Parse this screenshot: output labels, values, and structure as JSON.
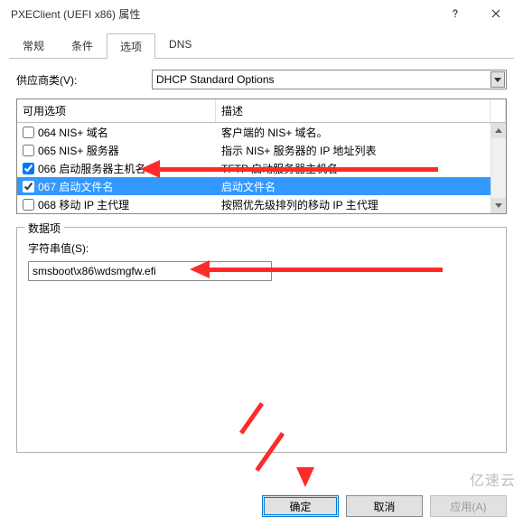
{
  "window": {
    "title": "PXEClient (UEFI x86) 属性"
  },
  "tabs": {
    "items": [
      {
        "label": "常规"
      },
      {
        "label": "条件"
      },
      {
        "label": "选项"
      },
      {
        "label": "DNS"
      }
    ],
    "activeIndex": 2
  },
  "vendor": {
    "label": "供应商类(V):",
    "value": "DHCP Standard Options"
  },
  "options": {
    "headerA": "可用选项",
    "headerB": "描述",
    "rows": [
      {
        "checked": false,
        "code": "064 NIS+ 域名",
        "desc": "客户端的 NIS+ 域名。"
      },
      {
        "checked": false,
        "code": "065 NIS+ 服务器",
        "desc": "指示 NIS+ 服务器的 IP 地址列表"
      },
      {
        "checked": true,
        "code": "066 启动服务器主机名",
        "desc": "TFTP 启动服务器主机名"
      },
      {
        "checked": true,
        "code": "067 启动文件名",
        "desc": "启动文件名",
        "selected": true
      },
      {
        "checked": false,
        "code": "068 移动 IP 主代理",
        "desc": "按照优先级排列的移动 IP 主代理"
      }
    ]
  },
  "dataGroup": {
    "legend": "数据项",
    "fieldLabel": "字符串值(S):",
    "fieldValue": "smsboot\\x86\\wdsmgfw.efi"
  },
  "buttons": {
    "ok": "确定",
    "cancel": "取消",
    "apply": "应用(A)"
  },
  "watermark": "亿速云"
}
